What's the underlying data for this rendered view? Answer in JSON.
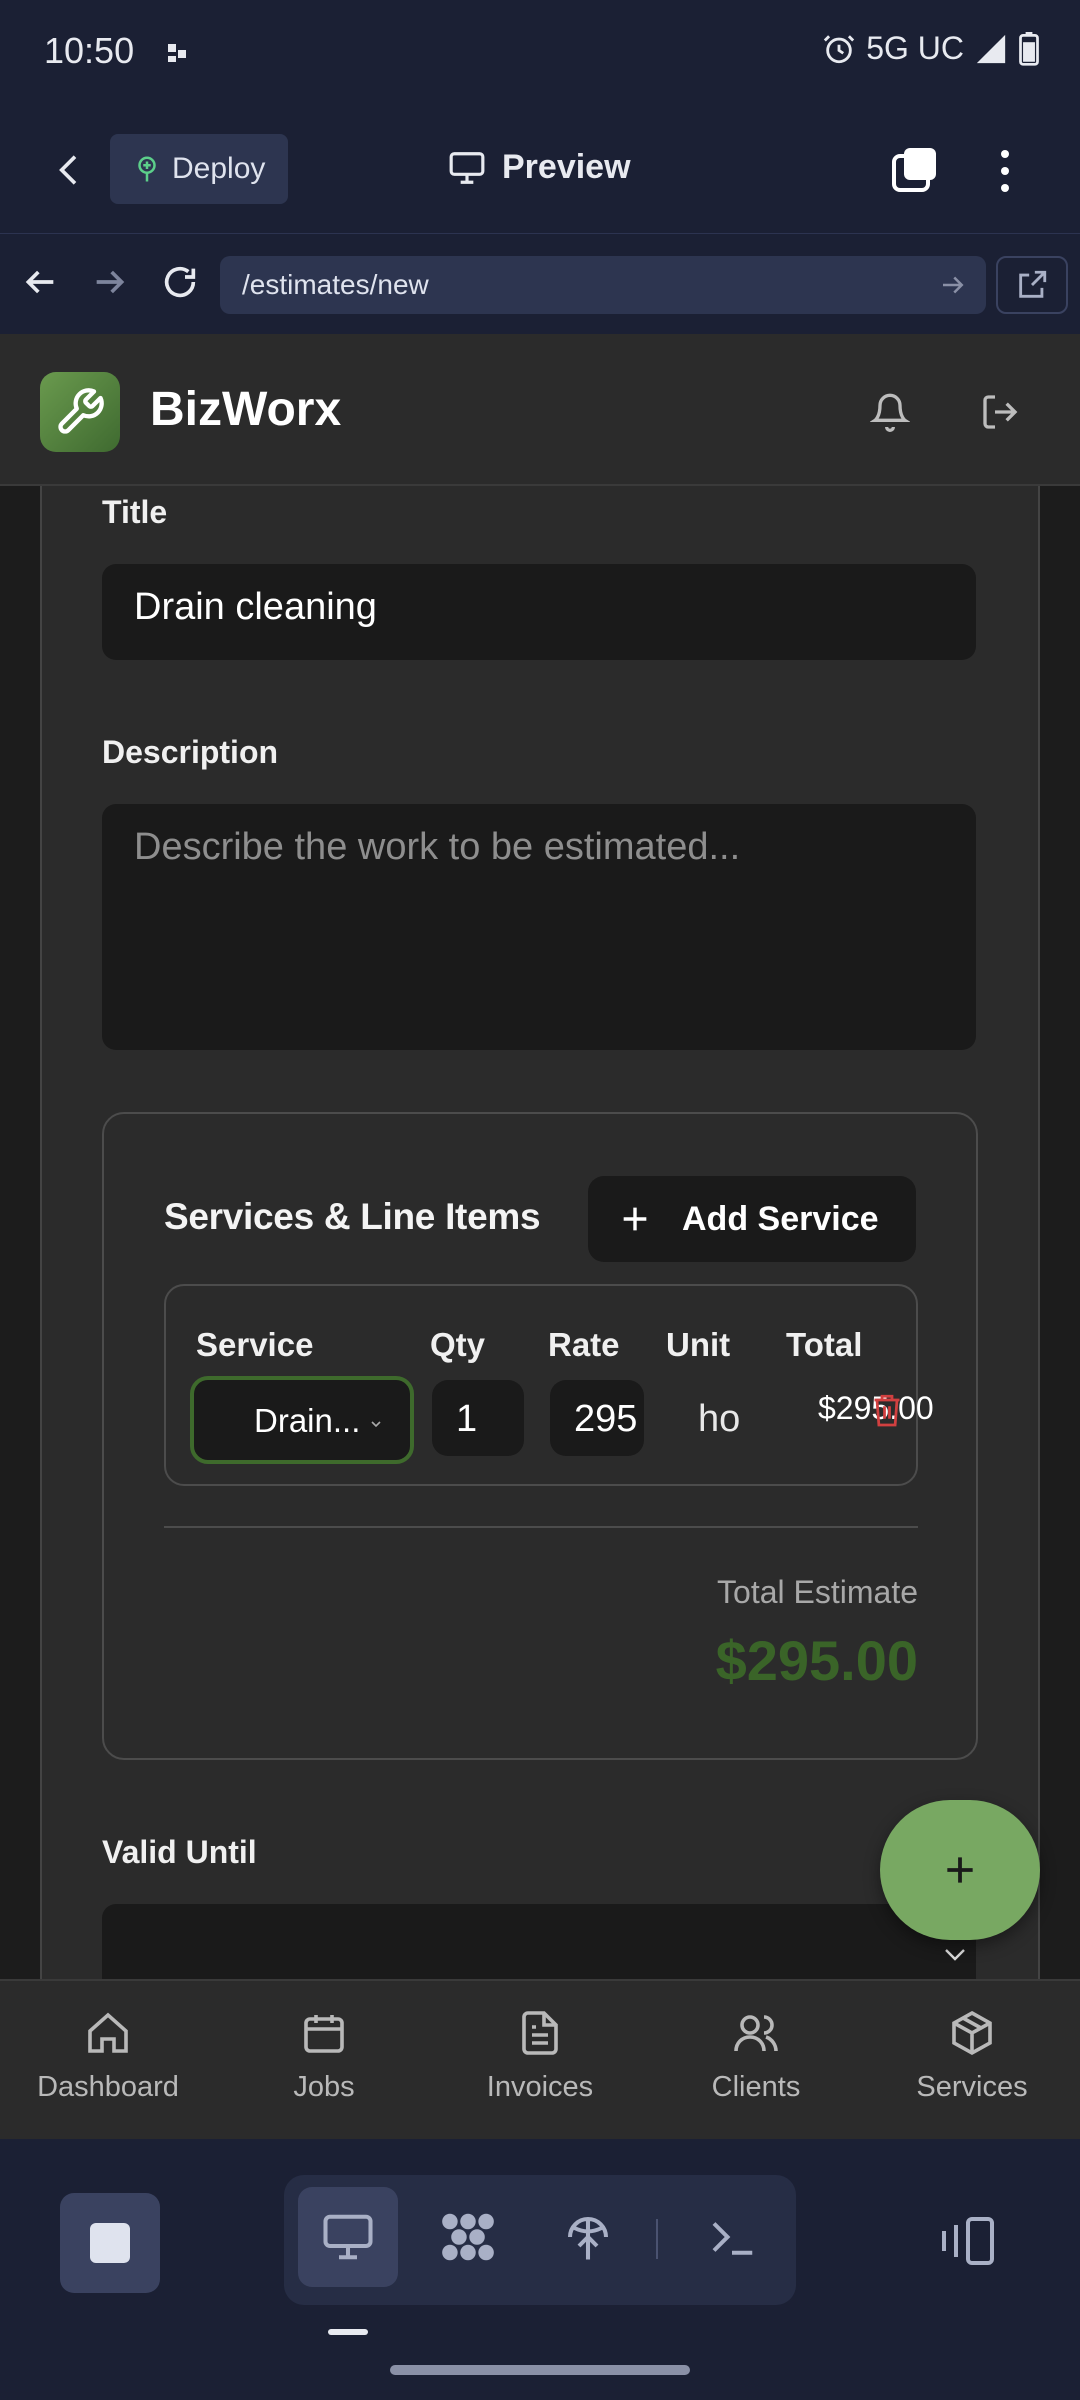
{
  "status": {
    "time": "10:50",
    "network": "5G UC"
  },
  "replit": {
    "deploy_label": "Deploy",
    "preview_label": "Preview",
    "url": "/estimates/new"
  },
  "app": {
    "brand": "BizWorx",
    "form": {
      "title_label": "Title",
      "title_value": "Drain cleaning",
      "description_label": "Description",
      "description_placeholder": "Describe the work to be estimated...",
      "services_title": "Services & Line Items",
      "add_service_label": "Add Service",
      "columns": [
        "Service",
        "Qty",
        "Rate",
        "Unit",
        "Total"
      ],
      "line_item": {
        "service": "Drain...",
        "qty": "1",
        "rate": "295",
        "unit": "hour",
        "total": "$295.00"
      },
      "total_estimate_label": "Total Estimate",
      "total_estimate_value": "$295.00",
      "valid_until_label": "Valid Until"
    },
    "nav": [
      {
        "label": "Dashboard",
        "icon": "home-icon"
      },
      {
        "label": "Jobs",
        "icon": "calendar-icon"
      },
      {
        "label": "Invoices",
        "icon": "file-text-icon"
      },
      {
        "label": "Clients",
        "icon": "users-icon"
      },
      {
        "label": "Services",
        "icon": "package-icon"
      }
    ]
  },
  "colors": {
    "accent_green": "#78a862",
    "total_green": "#3a6428",
    "delete_red": "#d14040"
  }
}
